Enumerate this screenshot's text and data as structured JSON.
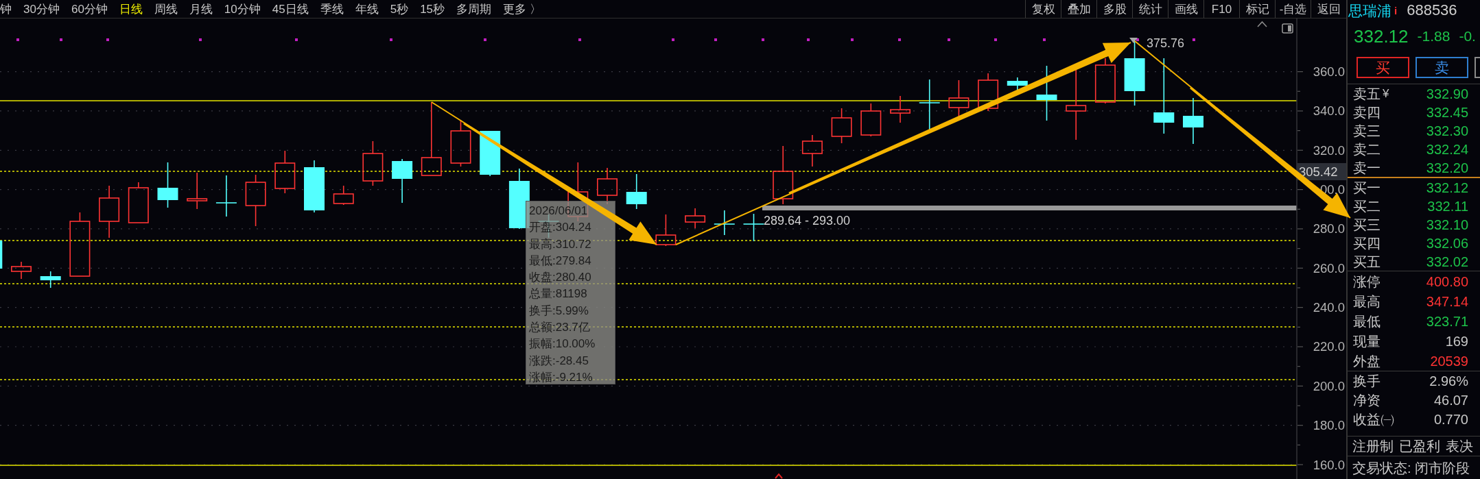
{
  "toolbar": {
    "periods": [
      {
        "label": "钟",
        "selected": false
      },
      {
        "label": "30分钟",
        "selected": false
      },
      {
        "label": "60分钟",
        "selected": false
      },
      {
        "label": "日线",
        "selected": true
      },
      {
        "label": "周线",
        "selected": false
      },
      {
        "label": "月线",
        "selected": false
      },
      {
        "label": "10分钟",
        "selected": false
      },
      {
        "label": "45日线",
        "selected": false
      },
      {
        "label": "季线",
        "selected": false
      },
      {
        "label": "年线",
        "selected": false
      },
      {
        "label": "5秒",
        "selected": false
      },
      {
        "label": "15秒",
        "selected": false
      },
      {
        "label": "多周期",
        "selected": false
      },
      {
        "label": "更多 〉",
        "selected": false
      }
    ],
    "tools": [
      "复权",
      "叠加",
      "多股",
      "统计",
      "画线",
      "F10",
      "标记",
      "-自选",
      "返回"
    ]
  },
  "chart": {
    "price_axis": [
      "360.0",
      "340.0",
      "320.0",
      "00.0",
      "280.0",
      "260.0",
      "240.0",
      "220.0",
      "200.0",
      "180.0",
      "160.0"
    ],
    "last_price_tag": "305.42",
    "high_label": "375.76",
    "range_label": "289.64 - 293.00",
    "tooltip": {
      "date": "2026/06/01",
      "lines": [
        "开盘:304.24",
        "最高:310.72",
        "最低:279.84",
        "收盘:280.40",
        "总量:81198",
        "换手:5.99%",
        "总额:23.7亿",
        "振幅:10.00%",
        "涨跌:-28.45",
        "涨幅:-9.21%"
      ]
    }
  },
  "stock": {
    "name": "思瑞浦",
    "badge": "i",
    "code": "688536"
  },
  "quote": {
    "price": "332.12",
    "change": "-1.88",
    "change_percent": "-0."
  },
  "trade_buttons": [
    {
      "kind": "buy",
      "label": "买"
    },
    {
      "kind": "sell",
      "label": "卖"
    },
    {
      "kind": "other"
    }
  ],
  "order_book": {
    "asks": [
      {
        "label": "卖五",
        "mark": "¥",
        "price": "332.90"
      },
      {
        "label": "卖四",
        "price": "332.45"
      },
      {
        "label": "卖三",
        "price": "332.30"
      },
      {
        "label": "卖二",
        "price": "332.24"
      },
      {
        "label": "卖一",
        "price": "332.20"
      }
    ],
    "bids": [
      {
        "label": "买一",
        "price": "332.12"
      },
      {
        "label": "买二",
        "price": "332.11"
      },
      {
        "label": "买三",
        "price": "332.10"
      },
      {
        "label": "买四",
        "price": "332.06"
      },
      {
        "label": "买五",
        "price": "332.02"
      }
    ]
  },
  "stats": [
    {
      "label": "涨停",
      "value": "400.80",
      "color": "#ff3333"
    },
    {
      "label": "最高",
      "value": "347.14",
      "color": "#ff3333"
    },
    {
      "label": "最低",
      "value": "323.71",
      "color": "#1dc34a"
    },
    {
      "label": "现量",
      "value": "169",
      "color": "#c8c8c8"
    },
    {
      "label": "外盘",
      "value": "20539",
      "color": "#ff3333"
    }
  ],
  "stats_more": [
    {
      "label": "换手",
      "value": "2.96%"
    },
    {
      "label": "净资",
      "value": "46.07"
    },
    {
      "label": "收益㈠",
      "value": "0.770"
    }
  ],
  "tags": [
    "注册制",
    "已盈利",
    "表决"
  ],
  "status": "交易状态: 闭市阶段"
}
